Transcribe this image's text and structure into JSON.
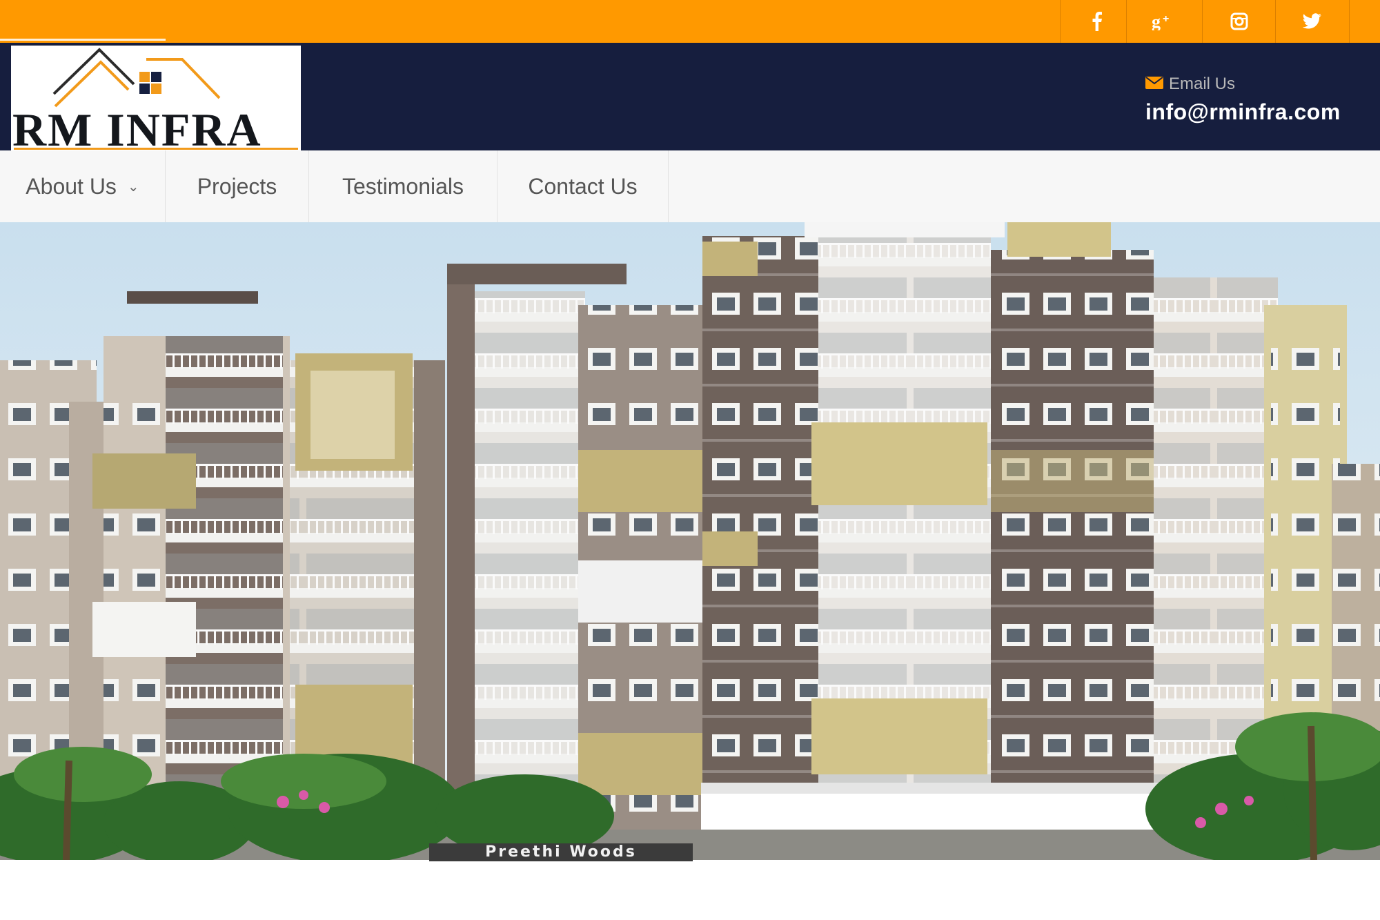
{
  "social": [
    {
      "icon": "facebook-icon",
      "glyph": "f"
    },
    {
      "icon": "google-plus-icon",
      "glyph": "g+"
    },
    {
      "icon": "instagram-icon",
      "glyph": ""
    },
    {
      "icon": "twitter-icon",
      "glyph": ""
    }
  ],
  "brand": {
    "name": "RM INFRA",
    "colors": {
      "orange": "#FF9900",
      "navy": "#161E3E",
      "nav_bg": "#f7f7f7"
    }
  },
  "contact": {
    "icon": "envelope-icon",
    "label": "Email Us",
    "email": "info@rminfra.com"
  },
  "nav": {
    "items": [
      {
        "label": "About Us",
        "has_dropdown": true
      },
      {
        "label": "Projects"
      },
      {
        "label": "Testimonials"
      },
      {
        "label": "Contact Us"
      }
    ]
  },
  "hero": {
    "caption": "Preethi Woods"
  }
}
